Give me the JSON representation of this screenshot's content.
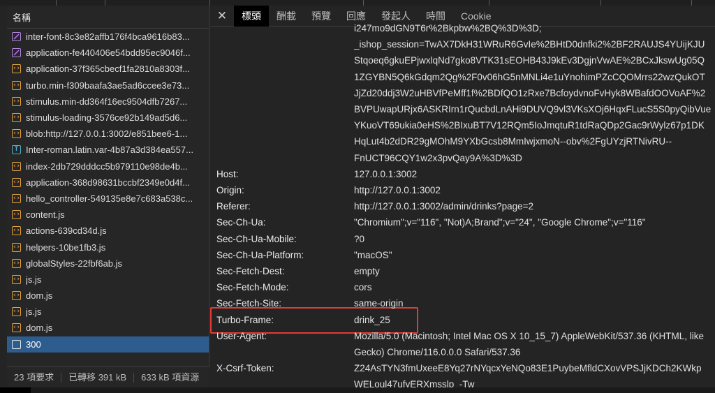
{
  "left_panel": {
    "header": "名稱",
    "files": [
      {
        "name": "inter-font-8c3e82affb176f4bca9616b83...",
        "type": "css"
      },
      {
        "name": "application-fe440406e54bdd95ec9046f...",
        "type": "css"
      },
      {
        "name": "application-37f365cbecf1fa2810a8303f...",
        "type": "js"
      },
      {
        "name": "turbo.min-f309baafa3ae5ad6ccee3e73...",
        "type": "js"
      },
      {
        "name": "stimulus.min-dd364f16ec9504dfb7267...",
        "type": "js"
      },
      {
        "name": "stimulus-loading-3576ce92b149ad5d6...",
        "type": "js"
      },
      {
        "name": "blob:http://127.0.0.1:3002/e851bee6-1...",
        "type": "js"
      },
      {
        "name": "Inter-roman.latin.var-4b87a3d384ea557...",
        "type": "font"
      },
      {
        "name": "index-2db729dddcc5b979110e98de4b...",
        "type": "js"
      },
      {
        "name": "application-368d98631bccbf2349e0d4f...",
        "type": "js"
      },
      {
        "name": "hello_controller-549135e8e7c683a538c...",
        "type": "js"
      },
      {
        "name": "content.js",
        "type": "js"
      },
      {
        "name": "actions-639cd34d.js",
        "type": "js"
      },
      {
        "name": "helpers-10be1fb3.js",
        "type": "js"
      },
      {
        "name": "globalStyles-22fbf6ab.js",
        "type": "js"
      },
      {
        "name": "js.js",
        "type": "js"
      },
      {
        "name": "dom.js",
        "type": "js"
      },
      {
        "name": "js.js",
        "type": "js"
      },
      {
        "name": "dom.js",
        "type": "js"
      },
      {
        "name": "300",
        "type": "doc",
        "selected": true
      }
    ],
    "status": {
      "requests": "23 項要求",
      "transferred": "已轉移 391 kB",
      "resources": "633 kB 項資源"
    }
  },
  "tabs": {
    "items": [
      "標頭",
      "酬載",
      "預覽",
      "回應",
      "發起人",
      "時間",
      "Cookie"
    ],
    "active": 0
  },
  "icons": {
    "close": "close-icon"
  },
  "headers": {
    "cookie_continuation": [
      "i247mo9dGN9T6r%2Bkpbw%2BQ%3D%3D;",
      "_ishop_session=TwAX7DkH31WRuR6GvIe%2BHtD0dnfki2%2BF2RAUJS4YUijKJU",
      "Stqoeq6gkuEPjwxlqNd7gko8VTK31sEOHB43J9kEv3DgjnVwAE%2BCxJkswUg05Q",
      "1ZGYBN5Q6kGdqm2Qg%2F0v06hG5nMNLi4e1uYnohimPZcCQOMrrs22wzQukOT",
      "JjZd20ddj3W2uHBVfPeMff1f%2BDfQO1zRxe7BcfoydvnoFvHyk8WBafdOOVoAF%2",
      "BVPUwapURjx6ASKRIrn1rQucbdLnAHi9DUVQ9vl3VKsXOj6HqxFLucS5S0pyQibVue",
      "YKuoVT69ukia0eHS%2BIxuBT7V12RQm5IoJmqtuR1tdRaQDp2Gac9rWylz67p1DK",
      "HqLut4b2dDR29gMOhM9YXbGcsb8MmIwjxmoN--obv%2FgUYzjRTNivRU--",
      "FnUCT96CQY1w2x3pvQay9A%3D%3D"
    ],
    "rows": [
      {
        "name": "Host:",
        "value": [
          "127.0.0.1:3002"
        ]
      },
      {
        "name": "Origin:",
        "value": [
          "http://127.0.0.1:3002"
        ]
      },
      {
        "name": "Referer:",
        "value": [
          "http://127.0.0.1:3002/admin/drinks?page=2"
        ]
      },
      {
        "name": "Sec-Ch-Ua:",
        "value": [
          "\"Chromium\";v=\"116\", \"Not)A;Brand\";v=\"24\", \"Google Chrome\";v=\"116\""
        ]
      },
      {
        "name": "Sec-Ch-Ua-Mobile:",
        "value": [
          "?0"
        ]
      },
      {
        "name": "Sec-Ch-Ua-Platform:",
        "value": [
          "\"macOS\""
        ]
      },
      {
        "name": "Sec-Fetch-Dest:",
        "value": [
          "empty"
        ]
      },
      {
        "name": "Sec-Fetch-Mode:",
        "value": [
          "cors"
        ]
      },
      {
        "name": "Sec-Fetch-Site:",
        "value": [
          "same-origin"
        ]
      },
      {
        "name": "Turbo-Frame:",
        "value": [
          "drink_25"
        ],
        "highlighted": true
      },
      {
        "name": "User-Agent:",
        "value": [
          "Mozilla/5.0 (Macintosh; Intel Mac OS X 10_15_7) AppleWebKit/537.36 (KHTML, like",
          "Gecko) Chrome/116.0.0.0 Safari/537.36"
        ]
      },
      {
        "name": "X-Csrf-Token:",
        "value": [
          "Z24AsTYN3fmUxeeE8Yq27rNYqcxYeNQo83E1PuybeMfldCXovVPSJjKDCh2KWkp",
          "WELoul47ufyERXmsslp_-Tw"
        ]
      }
    ]
  },
  "colors": {
    "highlight_border": "#e43a34",
    "selected_row": "#2d5d8f",
    "active_tab": "#000000"
  }
}
